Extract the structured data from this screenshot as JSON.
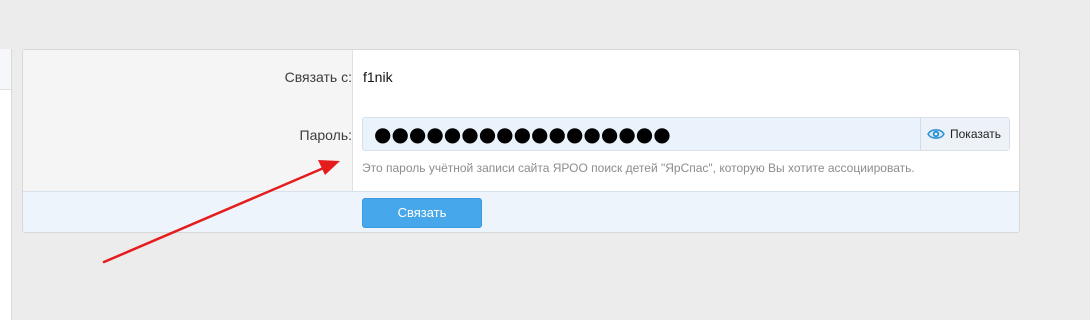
{
  "form": {
    "username_label": "Связать с:",
    "username_value": "f1nik",
    "password_label": "Пароль:",
    "password_masked": "●●●●●●●●●●●●●●●●●",
    "show_password_label": "Показать",
    "hint": "Это пароль учётной записи сайта ЯРОО поиск детей \"ЯрСпас\", которую Вы хотите ассоциировать.",
    "submit_label": "Связать"
  },
  "icons": {
    "show_password": "eye-icon"
  },
  "colors": {
    "accent": "#47a7eb",
    "annotation_arrow": "#e51c1c",
    "page_background": "#ececec"
  }
}
